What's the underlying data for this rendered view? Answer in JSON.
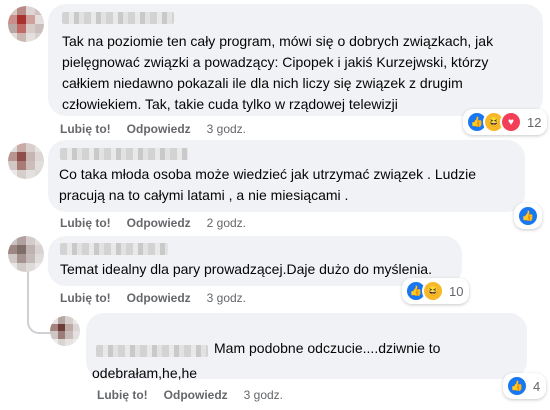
{
  "comments": [
    {
      "text": "Tak na poziomie ten cały program, mówi się o dobrych związkach, jak pielęgnować związki a powadzący: Cipopek i jakiś Kurzejwski, którzy całkiem niedawno pokazali ile dla nich liczy się związek z drugim człowiekiem. Tak, takie cuda tylko w rządowej telewizji",
      "like_label": "Lubię to!",
      "reply_label": "Odpowiedz",
      "time": "3 godz.",
      "reactions": [
        "like-icon",
        "haha-icon",
        "love-icon"
      ],
      "reaction_count": "12"
    },
    {
      "text": "Co taka młoda osoba może wiedzieć jak utrzymać związek . Ludzie pracują na to całymi latami , a nie miesiącami .",
      "like_label": "Lubię to!",
      "reply_label": "Odpowiedz",
      "time": "2 godz.",
      "reactions": [
        "like-icon"
      ],
      "reaction_count": ""
    },
    {
      "text": "Temat idealny dla pary prowadzącej.Daje dużo do myślenia.",
      "like_label": "Lubię to!",
      "reply_label": "Odpowiedz",
      "time": "3 godz.",
      "reactions": [
        "like-icon",
        "haha-icon"
      ],
      "reaction_count": "10"
    },
    {
      "text": "Mam podobne odczucie....dziwnie to odebrałam,he,he",
      "like_label": "Lubię to!",
      "reply_label": "Odpowiedz",
      "time": "3 godz.",
      "reactions": [
        "like-icon"
      ],
      "reaction_count": "4"
    }
  ],
  "colors": {
    "bubble": "#f0f2f5",
    "meta_text": "#65676b",
    "like": "#1877f2",
    "haha": "#f7b928",
    "love": "#f33e58"
  }
}
